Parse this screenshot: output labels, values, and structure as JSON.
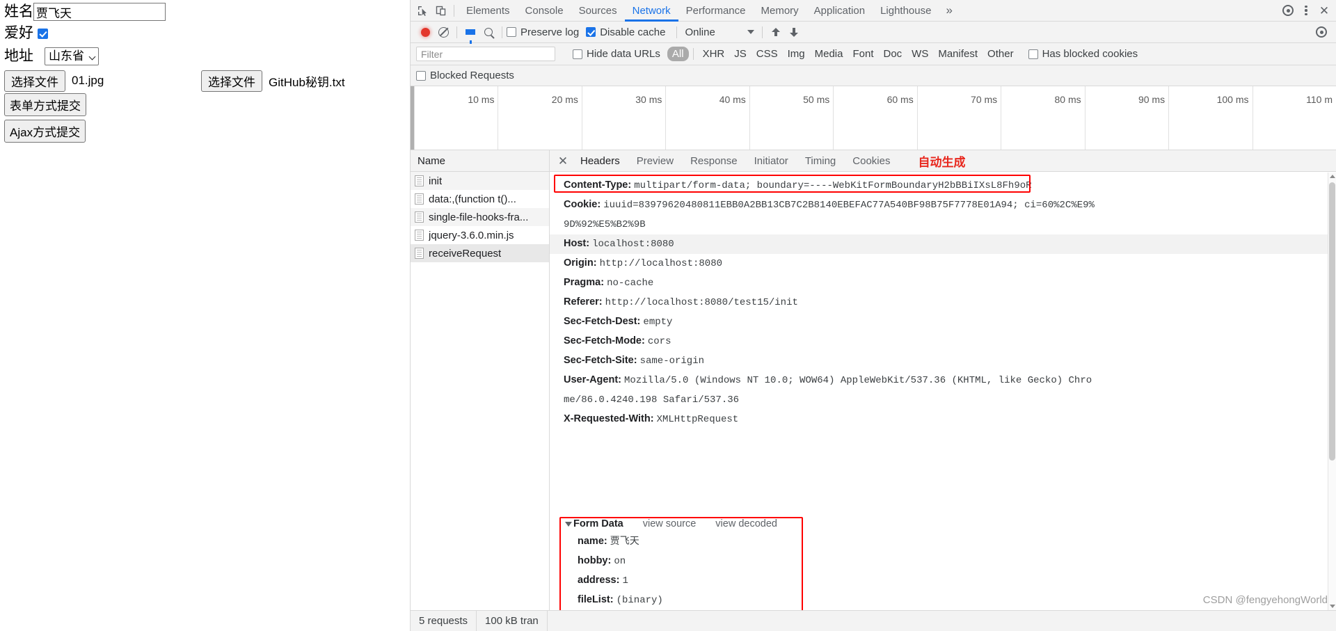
{
  "webpage": {
    "fields": [
      {
        "label": "姓名",
        "type": "text",
        "value": "贾飞天"
      },
      {
        "label": "爱好",
        "type": "checkbox",
        "checked": true
      },
      {
        "label": "地址",
        "type": "select",
        "value": "山东省"
      }
    ],
    "file_input_1": {
      "button": "选择文件",
      "filename": "01.jpg"
    },
    "file_input_2": {
      "button": "选择文件",
      "filename": "GitHub秘钥.txt"
    },
    "buttons": [
      {
        "label": "表单方式提交"
      },
      {
        "label": "Ajax方式提交"
      }
    ]
  },
  "devtools": {
    "main_tabs": [
      {
        "label": "Elements",
        "active": false
      },
      {
        "label": "Console",
        "active": false
      },
      {
        "label": "Sources",
        "active": false
      },
      {
        "label": "Network",
        "active": true
      },
      {
        "label": "Performance",
        "active": false
      },
      {
        "label": "Memory",
        "active": false
      },
      {
        "label": "Application",
        "active": false
      },
      {
        "label": "Lighthouse",
        "active": false
      }
    ],
    "more_tabs_glyph": "»",
    "network_toolbar": {
      "preserve_log": {
        "label": "Preserve log",
        "checked": false
      },
      "disable_cache": {
        "label": "Disable cache",
        "checked": true
      },
      "throttle_value": "Online"
    },
    "filter_bar": {
      "filter_placeholder": "Filter",
      "filter_value": "",
      "hide_data_urls": {
        "label": "Hide data URLs",
        "checked": false
      },
      "types": [
        {
          "label": "All",
          "active": true
        },
        {
          "label": "XHR",
          "active": false
        },
        {
          "label": "JS",
          "active": false
        },
        {
          "label": "CSS",
          "active": false
        },
        {
          "label": "Img",
          "active": false
        },
        {
          "label": "Media",
          "active": false
        },
        {
          "label": "Font",
          "active": false
        },
        {
          "label": "Doc",
          "active": false
        },
        {
          "label": "WS",
          "active": false
        },
        {
          "label": "Manifest",
          "active": false
        },
        {
          "label": "Other",
          "active": false
        }
      ],
      "has_blocked_cookies": {
        "label": "Has blocked cookies",
        "checked": false
      },
      "blocked_requests": {
        "label": "Blocked Requests",
        "checked": false
      }
    },
    "overview_ticks": [
      "10 ms",
      "20 ms",
      "30 ms",
      "40 ms",
      "50 ms",
      "60 ms",
      "70 ms",
      "80 ms",
      "90 ms",
      "100 ms",
      "110 m"
    ],
    "request_list": {
      "column_header": "Name",
      "rows": [
        {
          "name": "init",
          "selected": false
        },
        {
          "name": "data:,(function t()...",
          "selected": false
        },
        {
          "name": "single-file-hooks-fra...",
          "selected": false
        },
        {
          "name": "jquery-3.6.0.min.js",
          "selected": false
        },
        {
          "name": "receiveRequest",
          "selected": true
        }
      ]
    },
    "detail_tabs": [
      {
        "label": "Headers",
        "active": true
      },
      {
        "label": "Preview",
        "active": false
      },
      {
        "label": "Response",
        "active": false
      },
      {
        "label": "Initiator",
        "active": false
      },
      {
        "label": "Timing",
        "active": false
      },
      {
        "label": "Cookies",
        "active": false
      }
    ],
    "annotation": "自动生成",
    "headers": [
      {
        "key": "Content-Type:",
        "value": "multipart/form-data; boundary=----WebKitFormBoundaryH2bBBiIXsL8Fh9oR",
        "highlighted": true
      },
      {
        "key": "Cookie:",
        "value": "iuuid=83979620480811EBB0A2BB13CB7C2B8140EBEFAC77A540BF98B75F7778E01A94; ci=60%2C%E9%"
      },
      {
        "key": "",
        "value": "9D%92%E5%B2%9B",
        "continuation": true
      },
      {
        "key": "Host:",
        "value": "localhost:8080",
        "alt": true
      },
      {
        "key": "Origin:",
        "value": "http://localhost:8080"
      },
      {
        "key": "Pragma:",
        "value": "no-cache"
      },
      {
        "key": "Referer:",
        "value": "http://localhost:8080/test15/init"
      },
      {
        "key": "Sec-Fetch-Dest:",
        "value": "empty"
      },
      {
        "key": "Sec-Fetch-Mode:",
        "value": "cors"
      },
      {
        "key": "Sec-Fetch-Site:",
        "value": "same-origin"
      },
      {
        "key": "User-Agent:",
        "value": "Mozilla/5.0 (Windows NT 10.0; WOW64) AppleWebKit/537.36 (KHTML, like Gecko) Chro"
      },
      {
        "key": "",
        "value": "me/86.0.4240.198 Safari/537.36",
        "continuation": true
      },
      {
        "key": "X-Requested-With:",
        "value": "XMLHttpRequest"
      }
    ],
    "form_data": {
      "title": "Form Data",
      "view_source": "view source",
      "view_decoded": "view decoded",
      "rows": [
        {
          "key": "name:",
          "value": "贾飞天"
        },
        {
          "key": "hobby:",
          "value": "on"
        },
        {
          "key": "address:",
          "value": "1"
        },
        {
          "key": "fileList:",
          "value": "(binary)"
        }
      ]
    },
    "status_bar": {
      "requests": "5 requests",
      "transferred": "100 kB tran"
    }
  },
  "watermark": "CSDN @fengyehongWorld",
  "colors": {
    "accent": "#1a73e8",
    "record": "#e3362b",
    "annotation": "#e8261c",
    "redbox": "#ff0000"
  }
}
